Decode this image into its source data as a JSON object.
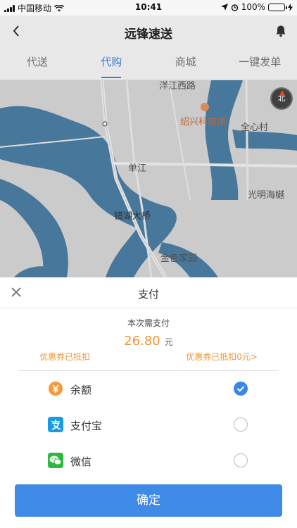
{
  "status_bar": {
    "carrier": "中国移动",
    "time": "10:41",
    "battery": "100%"
  },
  "nav": {
    "title": "远锋速送"
  },
  "tabs": [
    {
      "label": "代送"
    },
    {
      "label": "代购"
    },
    {
      "label": "商城"
    },
    {
      "label": "一键发单"
    }
  ],
  "map": {
    "labels": [
      "洋江西路",
      "绍兴科技馆",
      "全心村",
      "单江",
      "光明海樾",
      "镜湖大桥",
      "金色家园"
    ],
    "compass": "北"
  },
  "payment": {
    "title": "支付",
    "amount_label": "本次需支付",
    "amount": "26.80",
    "unit": "元",
    "coupon_left": "优惠券已抵扣",
    "coupon_right": "优惠券已抵扣0元>",
    "methods": [
      {
        "label": "余额",
        "icon": "yen-icon",
        "selected": true
      },
      {
        "label": "支付宝",
        "icon": "alipay-icon",
        "selected": false
      },
      {
        "label": "微信",
        "icon": "wechat-icon",
        "selected": false
      }
    ],
    "confirm_label": "确定"
  },
  "colors": {
    "accent": "#3a86e8",
    "price": "#f0963a",
    "water": "#4d7fa6"
  }
}
